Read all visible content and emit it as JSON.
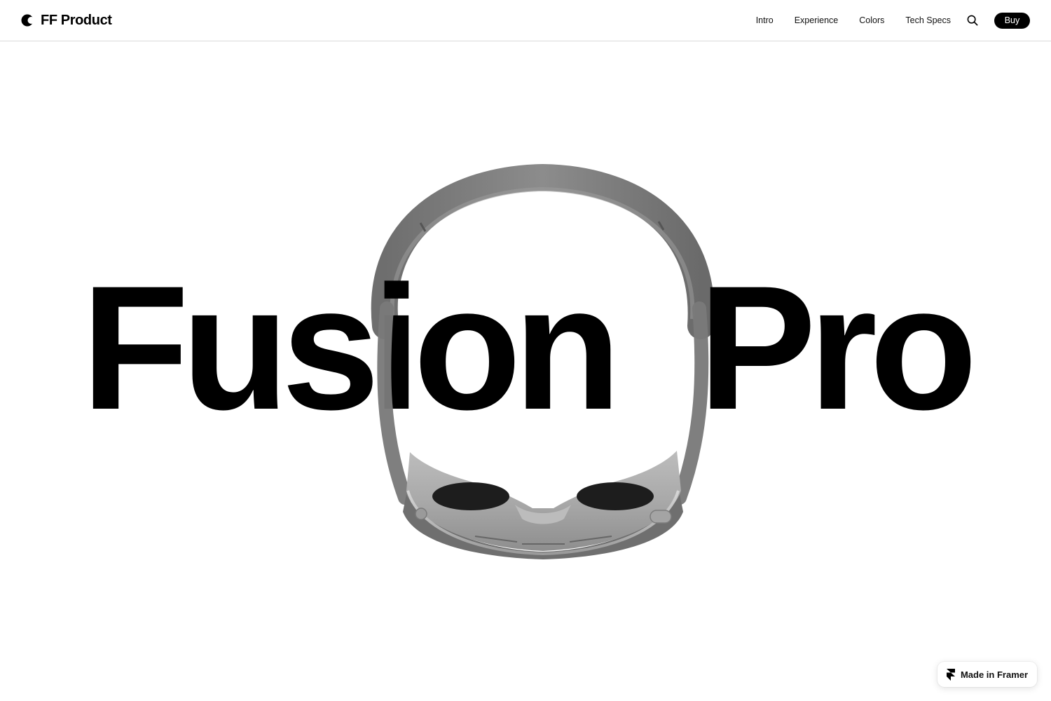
{
  "brand": {
    "name": "FF Product"
  },
  "nav": {
    "links": [
      "Intro",
      "Experience",
      "Colors",
      "Tech Specs"
    ],
    "buy_label": "Buy"
  },
  "hero": {
    "headline_part1": "Fusion",
    "headline_part2": "Pro"
  },
  "badge": {
    "label": "Made in Framer"
  },
  "icons": {
    "logo": "moon-logo-icon",
    "search": "search-icon",
    "framer": "framer-icon"
  },
  "colors": {
    "text": "#000000",
    "headset": "#8a8a8a",
    "background": "#ffffff"
  }
}
